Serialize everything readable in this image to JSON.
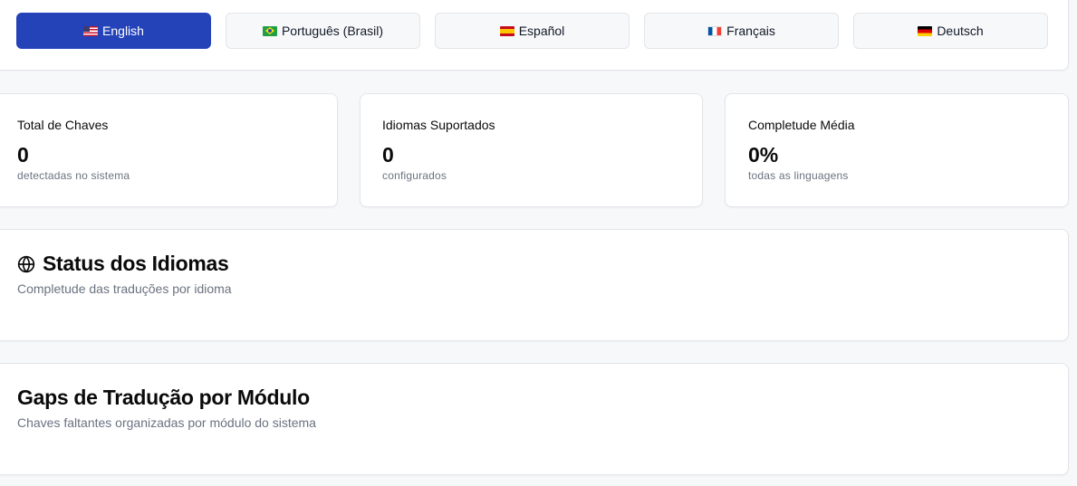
{
  "languages": [
    {
      "label": "English",
      "flag": "flag-us",
      "active": true
    },
    {
      "label": "Português (Brasil)",
      "flag": "flag-br",
      "active": false
    },
    {
      "label": "Español",
      "flag": "flag-es",
      "active": false
    },
    {
      "label": "Français",
      "flag": "flag-fr",
      "active": false
    },
    {
      "label": "Deutsch",
      "flag": "flag-de",
      "active": false
    }
  ],
  "stats": {
    "total_keys": {
      "label": "Total de Chaves",
      "value": "0",
      "sub": "detectadas no sistema"
    },
    "supported_languages": {
      "label": "Idiomas Suportados",
      "value": "0",
      "sub": "configurados"
    },
    "avg_completeness": {
      "label": "Completude Média",
      "value": "0%",
      "sub": "todas as linguagens"
    }
  },
  "language_status": {
    "icon": "globe-icon",
    "title": "Status dos Idiomas",
    "subtitle": "Completude das traduções por idioma"
  },
  "translation_gaps": {
    "title": "Gaps de Tradução por Módulo",
    "subtitle": "Chaves faltantes organizadas por módulo do sistema"
  },
  "colors": {
    "accent": "#2543b9",
    "background": "#f7f8fa",
    "muted_text": "#6b7280"
  }
}
